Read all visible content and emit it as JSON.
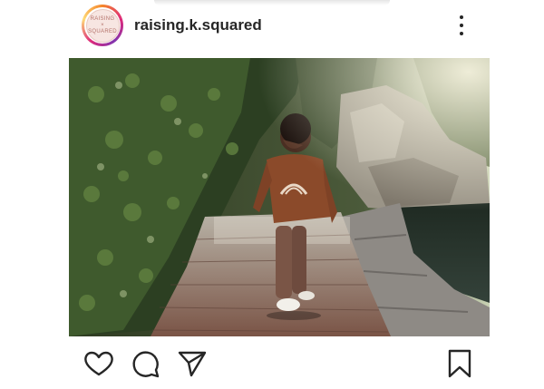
{
  "post": {
    "username": "raising.k.squared",
    "avatar_logo_lines": [
      "RAISING",
      "×",
      "SQUARED"
    ]
  },
  "icons": {
    "like": "heart-icon",
    "comment": "comment-icon",
    "share": "send-icon",
    "save": "bookmark-icon",
    "more": "more-vertical-icon"
  },
  "colors": {
    "text": "#262626",
    "background": "#ffffff",
    "avatar_ring": "#dd2a7b"
  }
}
